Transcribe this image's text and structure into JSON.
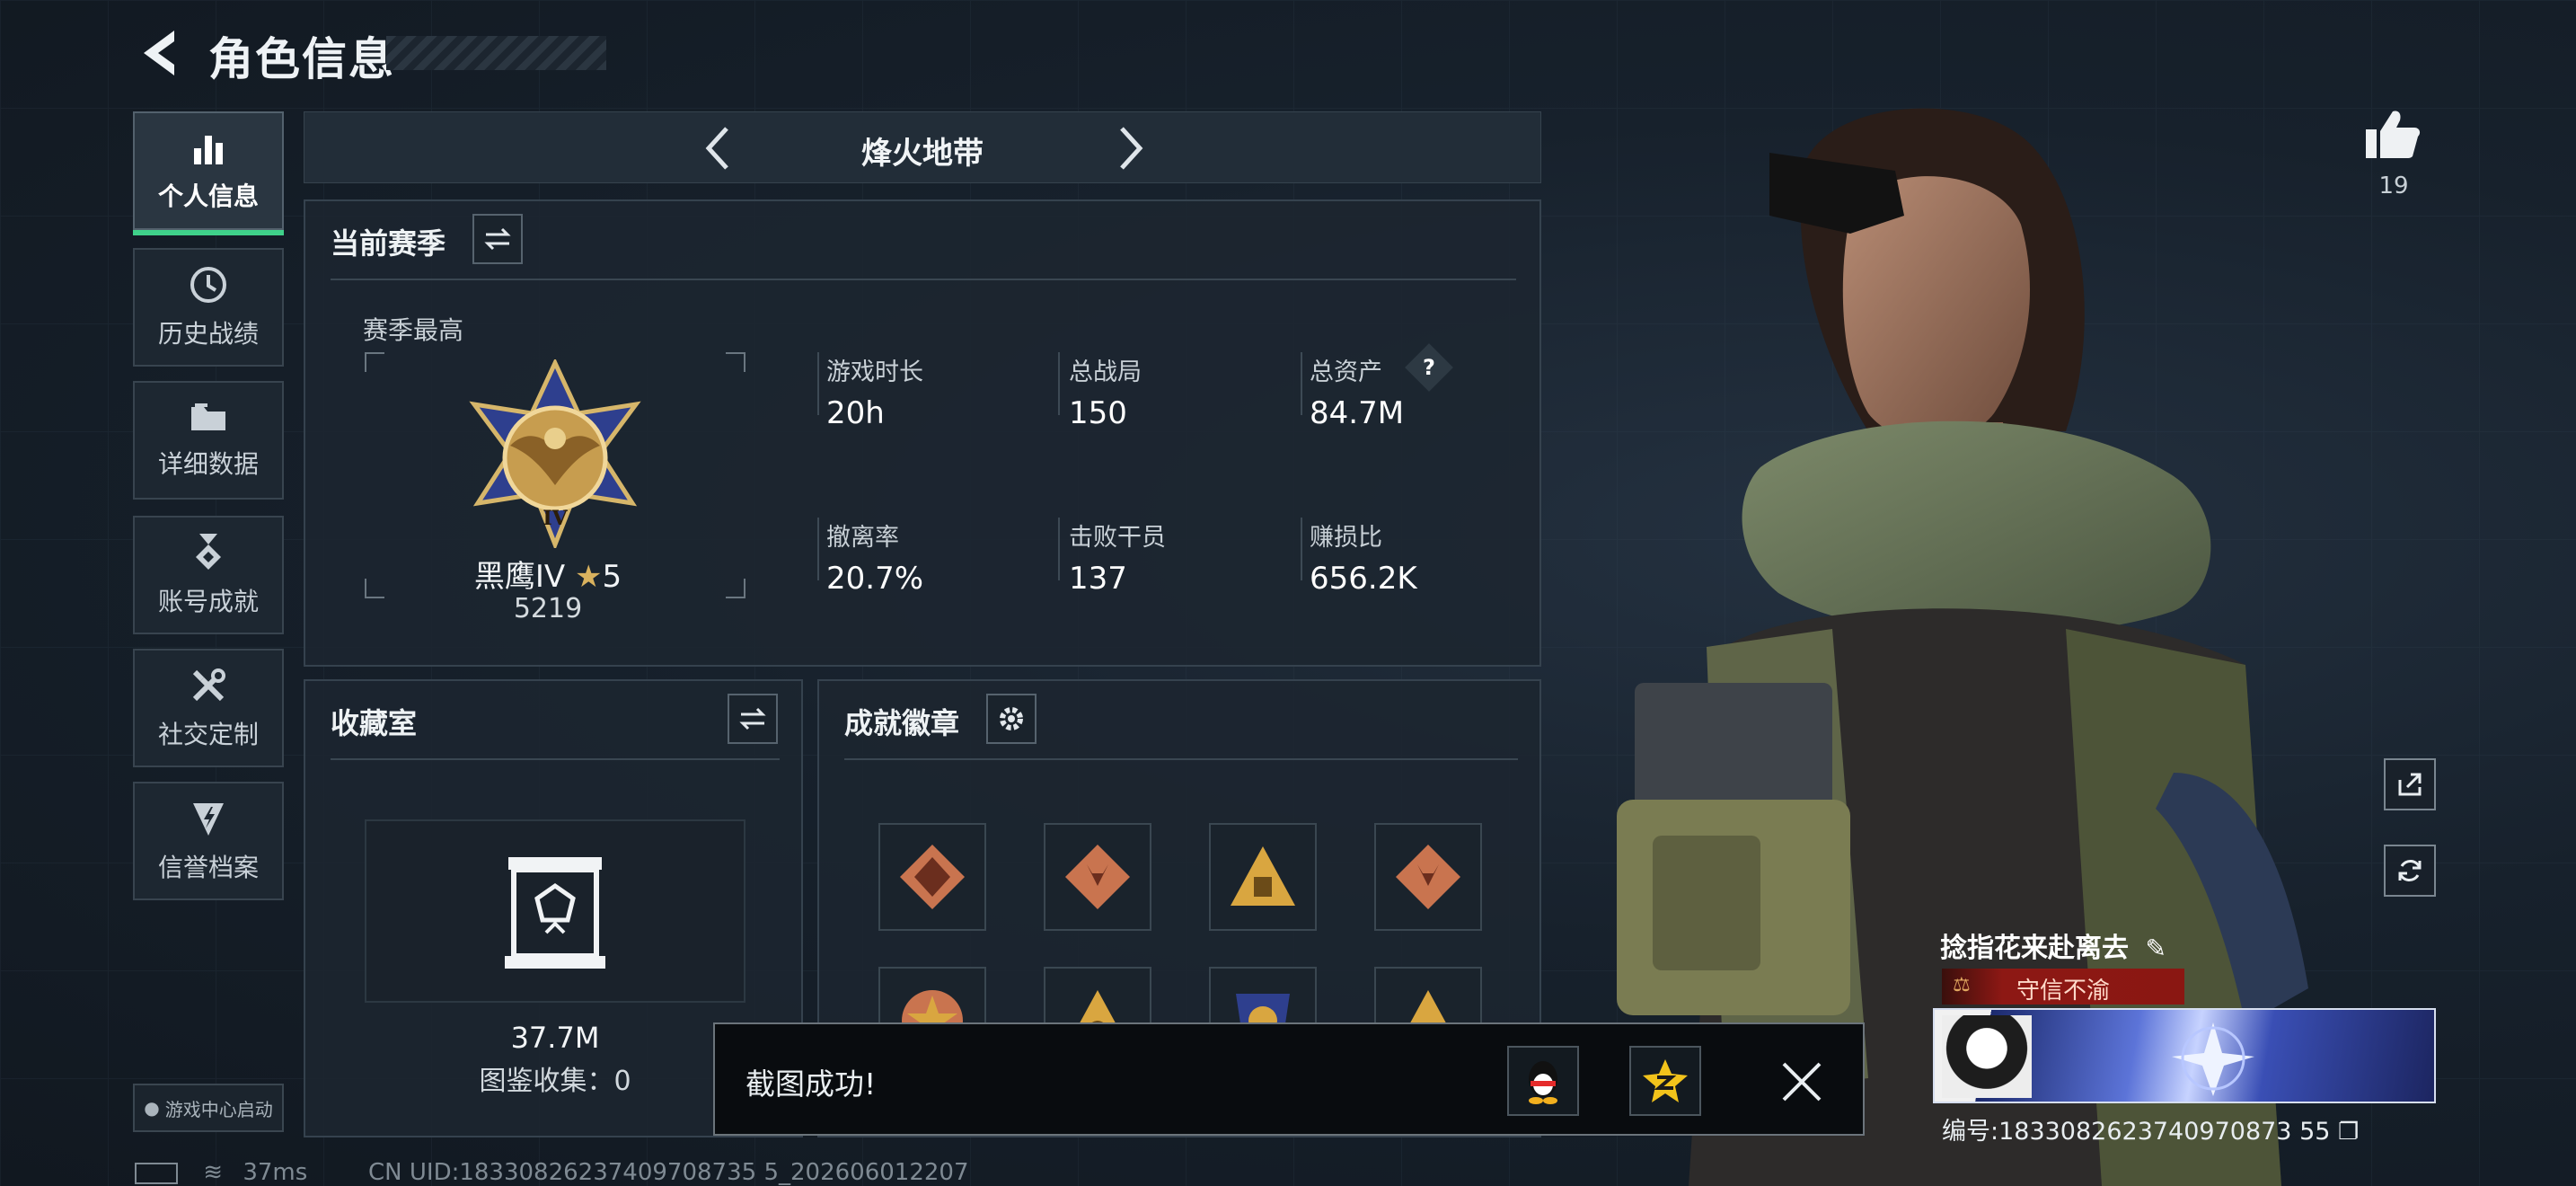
{
  "header": {
    "title": "角色信息"
  },
  "sidebar": {
    "items": [
      {
        "label": "个人信息",
        "icon": "bar-chart-icon",
        "active": true
      },
      {
        "label": "历史战绩",
        "icon": "history-clock-icon",
        "active": false
      },
      {
        "label": "详细数据",
        "icon": "folder-icon",
        "active": false
      },
      {
        "label": "账号成就",
        "icon": "medal-icon",
        "active": false
      },
      {
        "label": "社交定制",
        "icon": "tools-icon",
        "active": false
      },
      {
        "label": "信誉档案",
        "icon": "reputation-shield-icon",
        "active": false
      }
    ],
    "launcher_label": "游戏中心启动"
  },
  "mode": {
    "title": "烽火地带"
  },
  "season": {
    "title": "当前赛季",
    "best_label": "赛季最高",
    "rank_name": "黑鹰IV",
    "rank_stars": "5",
    "rank_score": "5219",
    "stats": [
      {
        "label": "游戏时长",
        "value": "20h"
      },
      {
        "label": "总战局",
        "value": "150"
      },
      {
        "label": "总资产",
        "value": "84.7M",
        "help": "?"
      },
      {
        "label": "撤离率",
        "value": "20.7%"
      },
      {
        "label": "击败干员",
        "value": "137"
      },
      {
        "label": "赚损比",
        "value": "656.2K"
      }
    ]
  },
  "collection": {
    "title": "收藏室",
    "value": "37.7M",
    "catalog_label": "图鉴收集：",
    "catalog_count": "0"
  },
  "badges": {
    "title": "成就徽章",
    "items": [
      {
        "icon": "dragon-badge-icon",
        "color": "#c9744f"
      },
      {
        "icon": "wolf-badge-icon",
        "color": "#c9744f"
      },
      {
        "icon": "triangle-badge-icon",
        "color": "#d9a640"
      },
      {
        "icon": "wolf-badge-icon",
        "color": "#c9744f"
      },
      {
        "icon": "star-emblem-badge-icon",
        "color": "#c9744f"
      },
      {
        "icon": "triangle-badge-icon",
        "color": "#d9a640"
      },
      {
        "icon": "crest-badge-icon",
        "color": "#d9a640"
      },
      {
        "icon": "triangle-badge-icon",
        "color": "#d9a640"
      }
    ]
  },
  "profile": {
    "likes": "19",
    "name": "捻指花来赴离去",
    "honor": "守信不渝",
    "uid_label": "编号:1833082623740970873 55"
  },
  "toast": {
    "text": "截图成功!"
  },
  "footer": {
    "ping": "37ms",
    "cn_uid": "CN UID:18330826237409708735 5_202606012207"
  },
  "colors": {
    "accent": "#3fd18a",
    "honor_red": "#8d1814",
    "badge_gold": "#d9a640"
  }
}
